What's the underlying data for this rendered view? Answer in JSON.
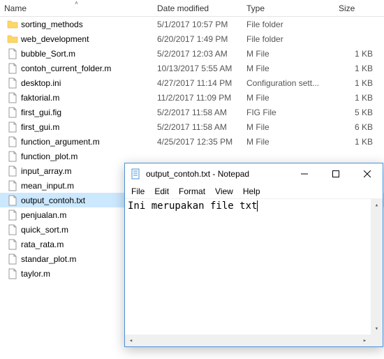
{
  "explorer": {
    "columns": {
      "name": "Name",
      "date": "Date modified",
      "type": "Type",
      "size": "Size"
    },
    "rows": [
      {
        "icon": "folder",
        "name": "sorting_methods",
        "date": "5/1/2017 10:57 PM",
        "type": "File folder",
        "size": ""
      },
      {
        "icon": "folder",
        "name": "web_development",
        "date": "6/20/2017 1:49 PM",
        "type": "File folder",
        "size": ""
      },
      {
        "icon": "file",
        "name": "bubble_Sort.m",
        "date": "5/2/2017 12:03 AM",
        "type": "M File",
        "size": "1 KB"
      },
      {
        "icon": "file",
        "name": "contoh_current_folder.m",
        "date": "10/13/2017 5:55 AM",
        "type": "M File",
        "size": "1 KB"
      },
      {
        "icon": "file",
        "name": "desktop.ini",
        "date": "4/27/2017 11:14 PM",
        "type": "Configuration sett...",
        "size": "1 KB"
      },
      {
        "icon": "file",
        "name": "faktorial.m",
        "date": "11/2/2017 11:09 PM",
        "type": "M File",
        "size": "1 KB"
      },
      {
        "icon": "file",
        "name": "first_gui.fig",
        "date": "5/2/2017 11:58 AM",
        "type": "FIG File",
        "size": "5 KB"
      },
      {
        "icon": "file",
        "name": "first_gui.m",
        "date": "5/2/2017 11:58 AM",
        "type": "M File",
        "size": "6 KB"
      },
      {
        "icon": "file",
        "name": "function_argument.m",
        "date": "4/25/2017 12:35 PM",
        "type": "M File",
        "size": "1 KB"
      },
      {
        "icon": "file",
        "name": "function_plot.m",
        "date": "",
        "type": "",
        "size": ""
      },
      {
        "icon": "file",
        "name": "input_array.m",
        "date": "",
        "type": "",
        "size": ""
      },
      {
        "icon": "file",
        "name": "mean_input.m",
        "date": "",
        "type": "",
        "size": ""
      },
      {
        "icon": "file",
        "name": "output_contoh.txt",
        "date": "",
        "type": "",
        "size": "",
        "selected": true
      },
      {
        "icon": "file",
        "name": "penjualan.m",
        "date": "",
        "type": "",
        "size": ""
      },
      {
        "icon": "file",
        "name": "quick_sort.m",
        "date": "",
        "type": "",
        "size": ""
      },
      {
        "icon": "file",
        "name": "rata_rata.m",
        "date": "",
        "type": "",
        "size": ""
      },
      {
        "icon": "file",
        "name": "standar_plot.m",
        "date": "",
        "type": "",
        "size": ""
      },
      {
        "icon": "file",
        "name": "taylor.m",
        "date": "",
        "type": "",
        "size": ""
      }
    ]
  },
  "notepad": {
    "title": "output_contoh.txt - Notepad",
    "menus": {
      "file": "File",
      "edit": "Edit",
      "format": "Format",
      "view": "View",
      "help": "Help"
    },
    "content": "Ini merupakan file txt"
  }
}
